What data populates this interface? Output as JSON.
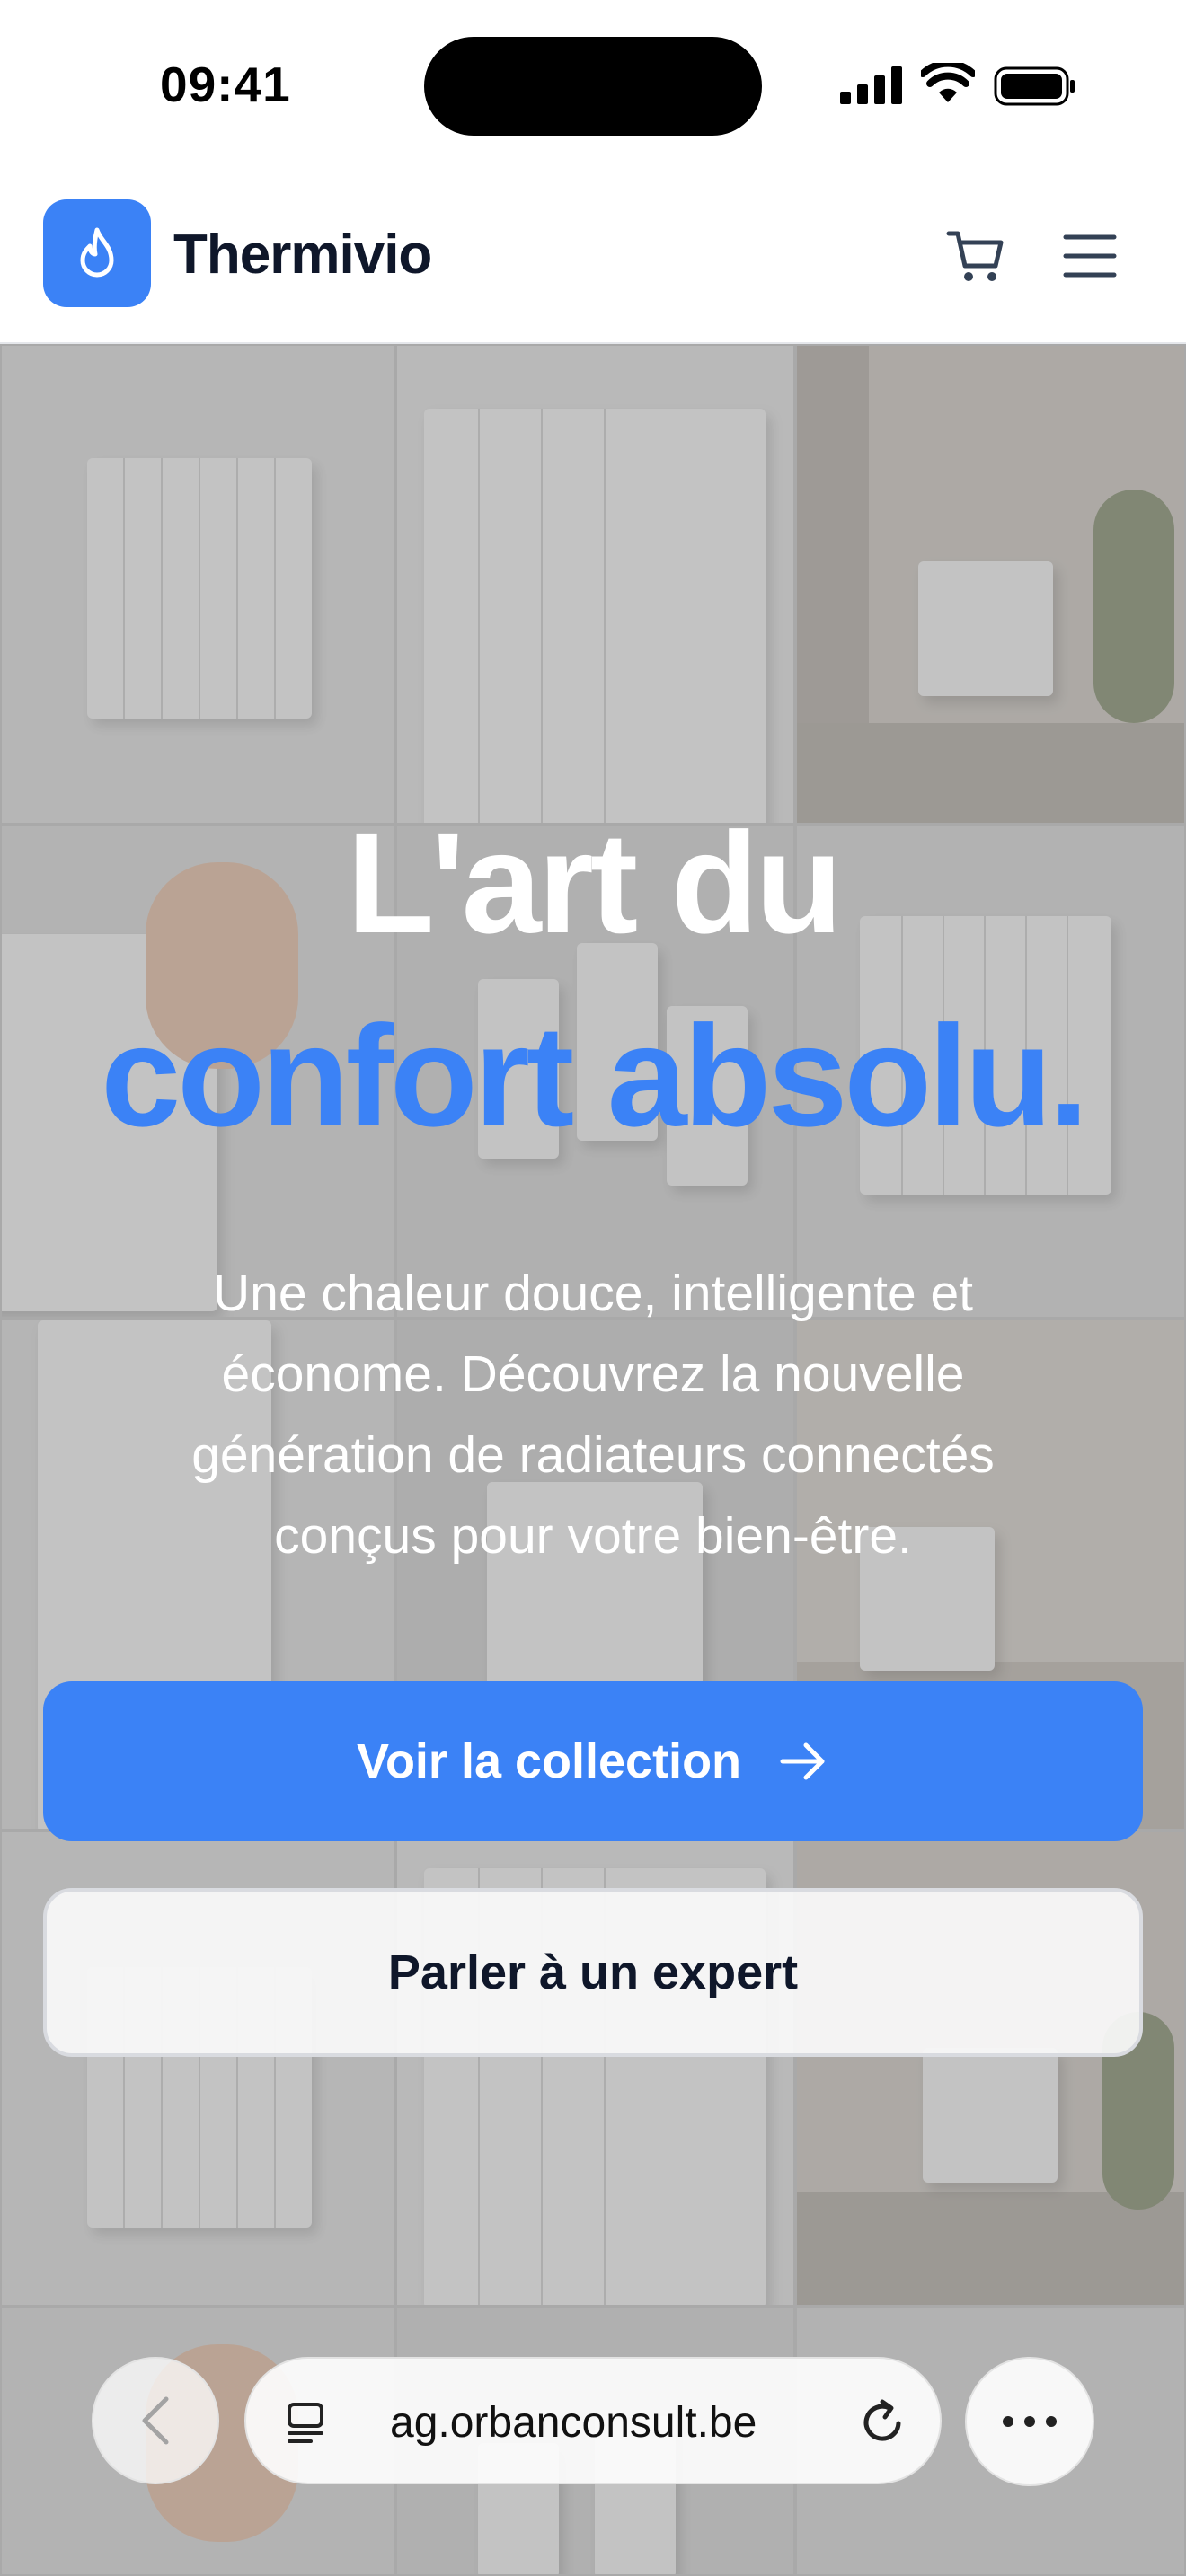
{
  "status_bar": {
    "time": "09:41"
  },
  "header": {
    "brand": "Thermivio"
  },
  "hero": {
    "title_line1": "L'art du",
    "title_line2": "confort absolu.",
    "subtitle": "Une chaleur douce, intelligente et économe. Découvrez la nouvelle génération de radiateurs connectés conçus pour votre bien-être.",
    "primary_cta": "Voir la collection",
    "secondary_cta": "Parler à un expert"
  },
  "browser": {
    "url": "ag.orbanconsult.be"
  },
  "colors": {
    "accent": "#3b82f6",
    "text_dark": "#0f172a"
  },
  "icons": [
    "flame-icon",
    "cart-icon",
    "menu-icon",
    "arrow-right-icon",
    "chevron-left-icon",
    "reader-icon",
    "reload-icon",
    "more-icon"
  ]
}
